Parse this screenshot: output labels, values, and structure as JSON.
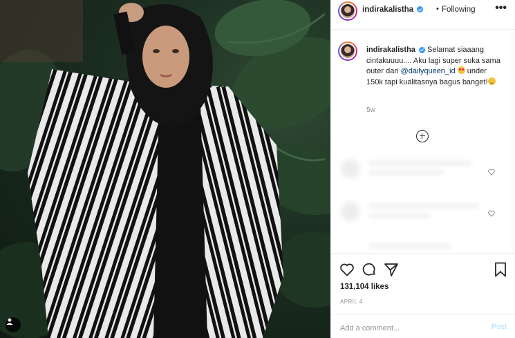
{
  "post": {
    "username": "indirakalistha",
    "verified": true,
    "separator": "•",
    "follow_status": "Following",
    "more_icon": "more-horizontal-icon",
    "caption": {
      "username": "indirakalistha",
      "text_1": "Selamat siaaang cintakuuuu.... Aku lagi super suka sama outer dari",
      "mention": "@dailyqueen_id",
      "text_2": "under 150k tapi kualitasnya bagus banget!"
    },
    "time_ago": "5w",
    "likes": "131,104 likes",
    "date": "APRIL 4"
  },
  "comment_input": {
    "placeholder": "Add a comment..."
  },
  "post_button": "Post",
  "colors": {
    "link": "#00376b",
    "verified": "#3897f0",
    "post_disabled": "#b2dffc",
    "muted": "#8e8e8e"
  }
}
